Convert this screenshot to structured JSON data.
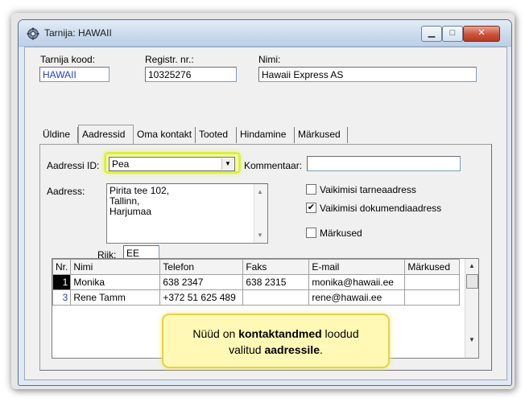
{
  "window": {
    "title": "Tarnija: HAWAII",
    "icon": "gear-icon"
  },
  "header": {
    "supplier_code_label": "Tarnija kood:",
    "supplier_code_value": "HAWAII",
    "reg_label": "Registr. nr.:",
    "reg_value": "10325276",
    "name_label": "Nimi:",
    "name_value": "Hawaii Express AS"
  },
  "tabs": [
    {
      "label": "Üldine",
      "active": false
    },
    {
      "label": "Aadressid",
      "active": true
    },
    {
      "label": "Oma kontakt",
      "active": false
    },
    {
      "label": "Tooted",
      "active": false
    },
    {
      "label": "Hindamine",
      "active": false
    },
    {
      "label": "Märkused",
      "active": false
    }
  ],
  "address_tab": {
    "address_id_label": "Aadressi ID:",
    "address_id_value": "Pea",
    "comment_label": "Kommentaar:",
    "comment_value": "",
    "address_label": "Aadress:",
    "address_line1": "Pirita tee 102,",
    "address_line2": "Tallinn,",
    "address_line3": "Harjumaa",
    "country_label": "Riik:",
    "country_value": "EE",
    "checkboxes": [
      {
        "label": "Vaikimisi tarneaadress",
        "checked": false
      },
      {
        "label": "Vaikimisi dokumendiaadress",
        "checked": true
      },
      {
        "label": "Märkused",
        "checked": false
      }
    ]
  },
  "contacts_table": {
    "columns": [
      "Nr.",
      "Nimi",
      "Telefon",
      "Faks",
      "E-mail",
      "Märkused"
    ],
    "rows": [
      {
        "nr": "1",
        "nimi": "Monika",
        "telefon": "638 2347",
        "faks": "638 2315",
        "email": "monika@hawaii.ee",
        "markused": ""
      },
      {
        "nr": "3",
        "nimi": "Rene Tamm",
        "telefon": "+372 51 625 489",
        "faks": "",
        "email": "rene@hawaii.ee",
        "markused": ""
      }
    ]
  },
  "callout": {
    "part1": "Nüüd on ",
    "part2": "kontaktandmed",
    "part3": " loodud",
    "part4": "valitud ",
    "part5": "aadressile",
    "part6": "."
  },
  "colors": {
    "highlight": "#f6fb9e",
    "callout_bg": "#fff9b5",
    "close_button": "#c9523a",
    "link_blue": "#1e3fc7"
  }
}
